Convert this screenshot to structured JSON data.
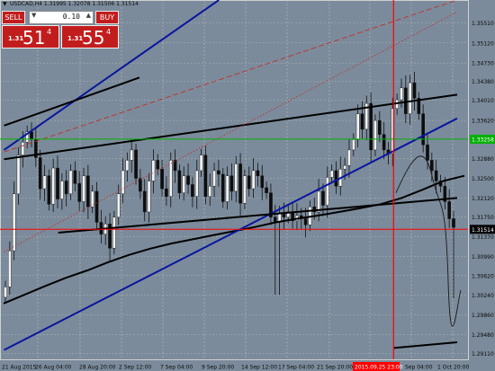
{
  "header": {
    "symbol": "USDCAD,H4",
    "ohlc": "1.31995 1.32078 1.31506 1.31514"
  },
  "trade_panel": {
    "sell_label": "SELL",
    "buy_label": "BUY",
    "lot_value": "0.10",
    "bid_prefix": "1.31",
    "bid_big": "51",
    "bid_sup": "4",
    "ask_prefix": "1.31",
    "ask_big": "55",
    "ask_sup": "4",
    "accent": "#c21d1d"
  },
  "colors": {
    "background": "#7b8b9b",
    "grid": "#c0c0c0",
    "up_candle": "#f2f2f2",
    "down_candle": "#0d0d0d",
    "blue_line": "#0a169e",
    "black_line": "#000000",
    "green_line": "#00b000",
    "red_line": "#ff0000",
    "price_label_bg": "#000000",
    "highlight_price_bg": "#00b000"
  },
  "price_axis": {
    "labels": [
      "1.35510",
      "1.35120",
      "1.34730",
      "1.34380",
      "1.34010",
      "1.33620",
      "1.33258",
      "1.32880",
      "1.32500",
      "1.32120",
      "1.31750",
      "1.31514",
      "1.31370",
      "1.30990",
      "1.30620",
      "1.30240",
      "1.29860",
      "1.29480",
      "1.29110"
    ],
    "current_price": "1.31514",
    "line_price": "1.33258"
  },
  "time_axis": {
    "labels": [
      "21 Aug 2015",
      "26 Aug 04:00",
      "28 Aug 20:00",
      "2 Sep 12:00",
      "7 Sep 04:00",
      "9 Sep 20:00",
      "14 Sep 12:00",
      "17 Sep 04:00",
      "21 Sep 20:00",
      "2015.09.25 23:00",
      "Sep 04:00",
      "1 Oct 20:00"
    ],
    "highlight_label": "2015.09.25 23:00"
  },
  "chart_data": {
    "type": "candlestick",
    "symbol": "USDCAD",
    "timeframe": "H4",
    "ylim": [
      1.29,
      1.3595
    ],
    "y_ticks": [
      1.3551,
      1.3512,
      1.3473,
      1.3438,
      1.3401,
      1.3362,
      1.33258,
      1.3288,
      1.325,
      1.3212,
      1.3175,
      1.31514,
      1.3137,
      1.3099,
      1.3062,
      1.3024,
      1.2986,
      1.2948,
      1.2911
    ],
    "series": [
      {
        "type": "candlestick",
        "close_path": [
          1.304,
          1.311,
          1.322,
          1.3295,
          1.332,
          1.334,
          1.3325,
          1.329,
          1.323,
          1.3255,
          1.32,
          1.327,
          1.321,
          1.3245,
          1.322,
          1.3265,
          1.324,
          1.3205,
          1.3255,
          1.3195,
          1.3225,
          1.3165,
          1.3142,
          1.3162,
          1.3115,
          1.3175,
          1.322,
          1.3265,
          1.3285,
          1.3305,
          1.325,
          1.3225,
          1.3185,
          1.3245,
          1.3285,
          1.3268,
          1.323,
          1.3215,
          1.3285,
          1.3265,
          1.3222,
          1.3255,
          1.3238,
          1.3215,
          1.3265,
          1.3295,
          1.3215,
          1.3235,
          1.3265,
          1.3258,
          1.3205,
          1.3255,
          1.3225,
          1.3278,
          1.3202,
          1.3255,
          1.323,
          1.3265,
          1.3255,
          1.3232,
          1.3222,
          1.3175,
          1.3165,
          1.3182,
          1.3175,
          1.3185,
          1.3168,
          1.3178,
          1.3172,
          1.316,
          1.3195,
          1.3185,
          1.3225,
          1.3198,
          1.3252,
          1.3265,
          1.3235,
          1.3268,
          1.3275,
          1.3305,
          1.3325,
          1.3375,
          1.3345,
          1.3395,
          1.3305,
          1.3362,
          1.3335,
          1.3305,
          1.3298,
          1.3385,
          1.3402,
          1.3425,
          1.3375,
          1.3435,
          1.3405,
          1.3375,
          1.3315,
          1.3285,
          1.3265,
          1.3245,
          1.3235,
          1.3205,
          1.3172,
          1.3155
        ]
      },
      {
        "name": "",
        "type": "trendline",
        "color": "#0a169e",
        "points": [
          [
            "2015-08-21",
            1.3305
          ],
          [
            "2015-09-09 20:00",
            1.3595
          ]
        ]
      },
      {
        "name": "",
        "type": "trendline",
        "color": "#0a169e",
        "points": [
          [
            "2015-08-21",
            1.2918
          ],
          [
            "2015-10-01 20:00",
            1.3366
          ]
        ]
      },
      {
        "name": "",
        "type": "trendline",
        "color": "#000000",
        "points": [
          [
            "2015-08-21",
            1.3287
          ],
          [
            "2015-10-01 20:00",
            1.3412
          ]
        ]
      },
      {
        "name": "",
        "type": "trendline",
        "color": "#000000",
        "points": [
          [
            "2015-08-21",
            1.3352
          ],
          [
            "2015-09-02 12:00",
            1.3445
          ]
        ]
      },
      {
        "name": "",
        "type": "trendline",
        "color": "#000000",
        "points": [
          [
            "2015-08-26",
            1.3145
          ],
          [
            "2015-10-01 20:00",
            1.3212
          ]
        ]
      },
      {
        "name": "",
        "type": "trendline",
        "color": "#000000",
        "points": [
          [
            "2015-09-25 23:00",
            1.2922
          ],
          [
            "2015-10-01 20:00",
            1.2933
          ]
        ]
      },
      {
        "name": "",
        "type": "dashed",
        "color": "#c03030",
        "points": [
          [
            "2015-08-21",
            1.3301
          ],
          [
            "2015-10-01 20:00",
            1.3595
          ]
        ]
      },
      {
        "name": "",
        "type": "dotted",
        "color": "#c03030",
        "points": [
          [
            "2015-08-21",
            1.3108
          ],
          [
            "2015-10-01 20:00",
            1.3572
          ]
        ]
      },
      {
        "name": "",
        "type": "horizontal",
        "color": "#00b000",
        "value": 1.33258
      },
      {
        "name": "",
        "type": "horizontal",
        "color": "#ff0000",
        "value": 1.31514
      },
      {
        "name": "",
        "type": "vertical",
        "color": "#ff0000",
        "at": "2015-09-25 23:00"
      }
    ]
  }
}
